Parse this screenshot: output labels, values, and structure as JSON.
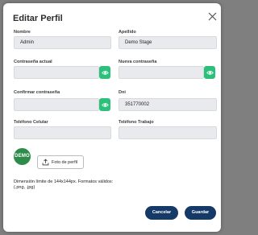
{
  "modal": {
    "title": "Editar Perfil"
  },
  "fields": {
    "nombre": {
      "label": "Nombre",
      "value": "Admin"
    },
    "apellido": {
      "label": "Apellido",
      "value": "Demo Stage"
    },
    "contrasena_actual": {
      "label": "Contraseña actual",
      "value": ""
    },
    "nueva_contrasena": {
      "label": "Nueva contraseña",
      "value": ""
    },
    "confirmar_contrasena": {
      "label": "Confirmar contraseña",
      "value": ""
    },
    "dni": {
      "label": "Dni",
      "value": "351770002"
    },
    "telefono_celular": {
      "label": "Teléfono Celular",
      "value": ""
    },
    "telefono_trabajo": {
      "label": "Teléfono Trabajo",
      "value": ""
    }
  },
  "avatar": {
    "text": "DEMO",
    "color": "#2d8c4a"
  },
  "photo_button": {
    "label": "Foto de perfil",
    "icon": "upload-icon"
  },
  "hint": "Dimensión límite de 144x144px. Formatos válidos: (.png, .jpg)",
  "actions": {
    "cancel_label": "Cancelar",
    "save_label": "Guardar"
  },
  "colors": {
    "primary": "#163a68",
    "eye_button": "#2cc07c",
    "field_bg": "#e9eaed"
  }
}
